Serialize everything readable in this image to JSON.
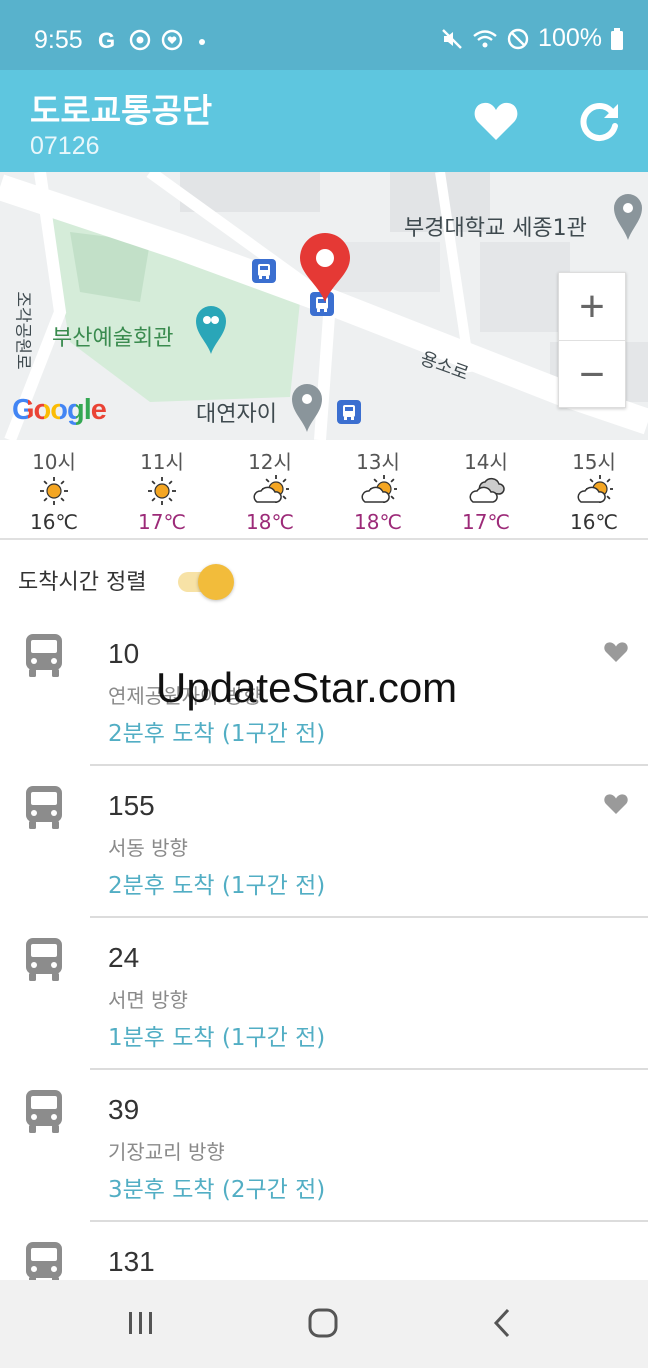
{
  "status": {
    "time": "9:55",
    "battery": "100%"
  },
  "app": {
    "title": "도로교통공단",
    "subtitle": "07126"
  },
  "map": {
    "labels": {
      "univ": "부경대학교 세종1관",
      "hall": "부산예술회관",
      "apt": "대연자이",
      "road1": "용소로",
      "road2": "조각공원로",
      "google": "Google"
    },
    "zoom_in": "+",
    "zoom_out": "−"
  },
  "weather": [
    {
      "hour": "10시",
      "icon": "sun-icon",
      "temp": "16℃",
      "color": "#333333"
    },
    {
      "hour": "11시",
      "icon": "sun-icon",
      "temp": "17℃",
      "color": "#9c2a78"
    },
    {
      "hour": "12시",
      "icon": "partly-cloudy-icon",
      "temp": "18℃",
      "color": "#9c2a78"
    },
    {
      "hour": "13시",
      "icon": "partly-cloudy-icon",
      "temp": "18℃",
      "color": "#9c2a78"
    },
    {
      "hour": "14시",
      "icon": "cloudy-icon",
      "temp": "17℃",
      "color": "#9c2a78"
    },
    {
      "hour": "15시",
      "icon": "partly-cloudy-icon",
      "temp": "16℃",
      "color": "#333333"
    }
  ],
  "sort": {
    "label": "도착시간 정렬",
    "enabled": true
  },
  "buses": [
    {
      "number": "10",
      "direction": "연제공원자이 방향",
      "arrival": "2분후 도착 (1구간 전)",
      "favorite": true
    },
    {
      "number": "155",
      "direction": "서동 방향",
      "arrival": "2분후 도착 (1구간 전)",
      "favorite": true
    },
    {
      "number": "24",
      "direction": "서면 방향",
      "arrival": "1분후 도착 (1구간 전)",
      "favorite": false
    },
    {
      "number": "39",
      "direction": "기장교리 방향",
      "arrival": "3분후 도착 (2구간 전)",
      "favorite": false
    },
    {
      "number": "131",
      "direction": "",
      "arrival": "",
      "favorite": false
    }
  ],
  "watermark": "UpdateStar.com",
  "colors": {
    "header": "#5ec6df",
    "status_bar": "#58b2cc",
    "arrival": "#52aec4",
    "toggle": "#f2bc3b",
    "pin": "#e53935"
  }
}
